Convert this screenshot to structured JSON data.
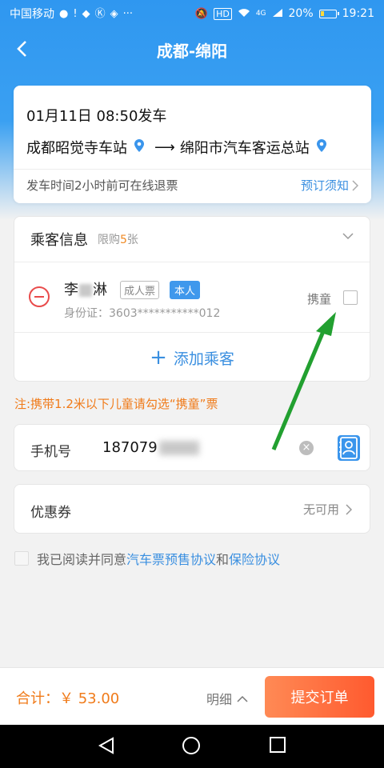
{
  "status_bar": {
    "carrier": "中国移动",
    "network": "4G",
    "hd": "HD",
    "battery": "20%",
    "time": "19:21"
  },
  "nav": {
    "title": "成都-绵阳"
  },
  "trip": {
    "departure": "01月11日  08:50发车",
    "from": "成都昭觉寺车站",
    "arrow": "⟶",
    "to": "绵阳市汽车客运总站",
    "refund_note": "发车时间2小时前可在线退票",
    "booking_notice": "预订须知"
  },
  "passengers": {
    "title": "乘客信息",
    "limit_prefix": "限购",
    "limit_num": "5",
    "limit_suffix": "张",
    "list": [
      {
        "name_first": "李",
        "name_last": "淋",
        "ticket_type": "成人票",
        "self_tag": "本人",
        "id_label": "身份证：",
        "id_value": "3603***********012",
        "child_label": "携童"
      }
    ],
    "add_label": "添加乘客"
  },
  "child_note": "注:携带1.2米以下儿童请勾选“携童”票",
  "phone": {
    "label": "手机号",
    "value": "187079"
  },
  "coupon": {
    "label": "优惠券",
    "value": "无可用"
  },
  "agreement": {
    "prefix": "我已阅读并同意",
    "link1": "汽车票预售协议",
    "middle": "和",
    "link2": "保险协议"
  },
  "footer": {
    "total": "合计：￥ 53.00",
    "detail": "明细",
    "submit": "提交订单"
  },
  "colors": {
    "primary": "#3a8fe0",
    "accent": "#f07b1a",
    "danger": "#e94b4b",
    "annotation_arrow": "#22a030"
  }
}
